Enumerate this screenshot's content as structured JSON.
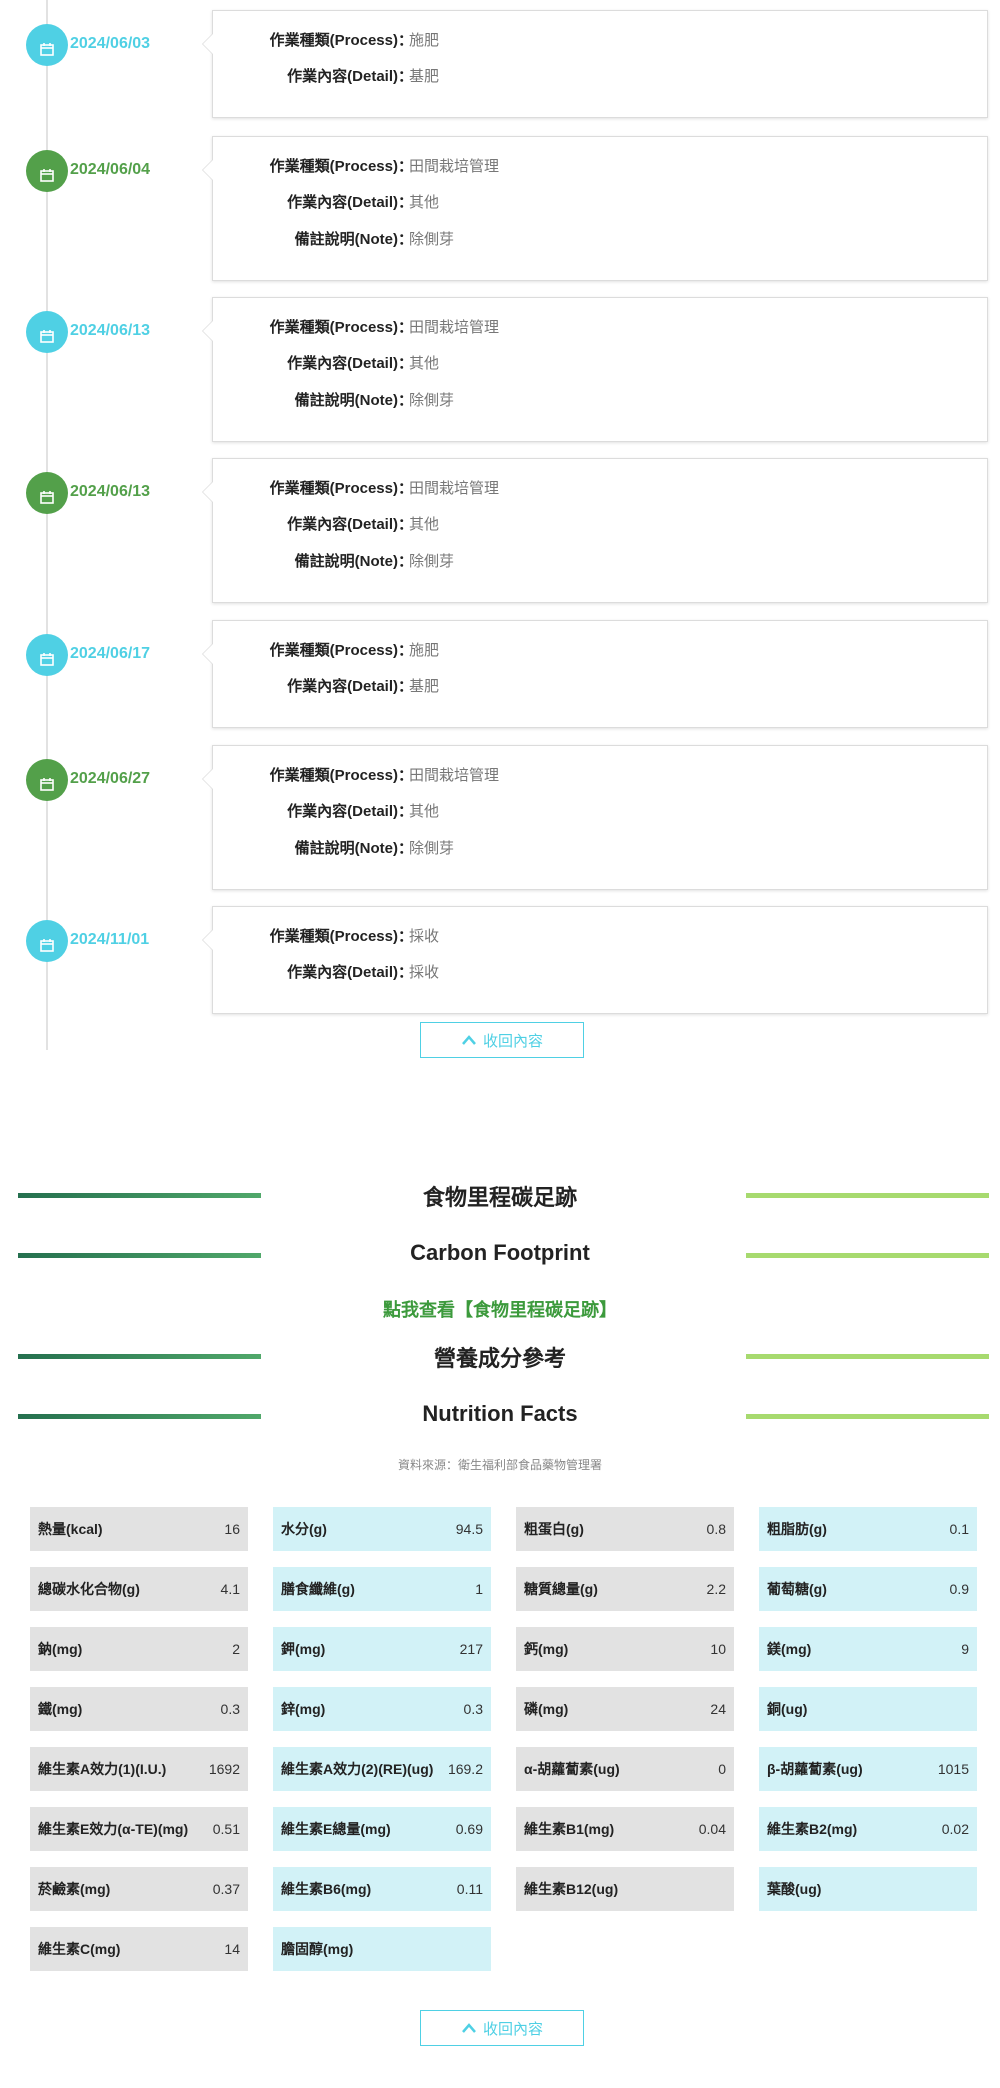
{
  "timeline": [
    {
      "date": "2024/06/03",
      "color": "cyan",
      "rows": [
        {
          "label": "作業種類(Process)：",
          "value": "施肥"
        },
        {
          "label": "作業內容(Detail)：",
          "value": "基肥"
        }
      ]
    },
    {
      "date": "2024/06/04",
      "color": "green",
      "rows": [
        {
          "label": "作業種類(Process)：",
          "value": "田間栽培管理"
        },
        {
          "label": "作業內容(Detail)：",
          "value": "其他"
        },
        {
          "label": "備註說明(Note)：",
          "value": "除側芽"
        }
      ]
    },
    {
      "date": "2024/06/13",
      "color": "cyan",
      "rows": [
        {
          "label": "作業種類(Process)：",
          "value": "田間栽培管理"
        },
        {
          "label": "作業內容(Detail)：",
          "value": "其他"
        },
        {
          "label": "備註說明(Note)：",
          "value": "除側芽"
        }
      ]
    },
    {
      "date": "2024/06/13",
      "color": "green",
      "rows": [
        {
          "label": "作業種類(Process)：",
          "value": "田間栽培管理"
        },
        {
          "label": "作業內容(Detail)：",
          "value": "其他"
        },
        {
          "label": "備註說明(Note)：",
          "value": "除側芽"
        }
      ]
    },
    {
      "date": "2024/06/17",
      "color": "cyan",
      "rows": [
        {
          "label": "作業種類(Process)：",
          "value": "施肥"
        },
        {
          "label": "作業內容(Detail)：",
          "value": "基肥"
        }
      ]
    },
    {
      "date": "2024/06/27",
      "color": "green",
      "rows": [
        {
          "label": "作業種類(Process)：",
          "value": "田間栽培管理"
        },
        {
          "label": "作業內容(Detail)：",
          "value": "其他"
        },
        {
          "label": "備註說明(Note)：",
          "value": "除側芽"
        }
      ]
    },
    {
      "date": "2024/11/01",
      "color": "cyan",
      "rows": [
        {
          "label": "作業種類(Process)：",
          "value": "採收"
        },
        {
          "label": "作業內容(Detail)：",
          "value": "採收"
        }
      ]
    }
  ],
  "collapse_label": "收回內容",
  "carbon": {
    "title_zh": "食物里程碳足跡",
    "title_en": "Carbon Footprint",
    "link": "點我查看【食物里程碳足跡】"
  },
  "nutrition": {
    "title_zh": "營養成分參考",
    "title_en": "Nutrition Facts",
    "source": "資料來源：衛生福利部食品藥物管理署",
    "items": [
      {
        "name": "熱量(kcal)",
        "value": "16"
      },
      {
        "name": "水分(g)",
        "value": "94.5"
      },
      {
        "name": "粗蛋白(g)",
        "value": "0.8"
      },
      {
        "name": "粗脂肪(g)",
        "value": "0.1"
      },
      {
        "name": "總碳水化合物(g)",
        "value": "4.1"
      },
      {
        "name": "膳食纖維(g)",
        "value": "1"
      },
      {
        "name": "糖質總量(g)",
        "value": "2.2"
      },
      {
        "name": "葡萄糖(g)",
        "value": "0.9"
      },
      {
        "name": "鈉(mg)",
        "value": "2"
      },
      {
        "name": "鉀(mg)",
        "value": "217"
      },
      {
        "name": "鈣(mg)",
        "value": "10"
      },
      {
        "name": "鎂(mg)",
        "value": "9"
      },
      {
        "name": "鐵(mg)",
        "value": "0.3"
      },
      {
        "name": "鋅(mg)",
        "value": "0.3"
      },
      {
        "name": "磷(mg)",
        "value": "24"
      },
      {
        "name": "銅(ug)",
        "value": ""
      },
      {
        "name": "維生素A效力(1)(I.U.)",
        "value": "1692"
      },
      {
        "name": "維生素A效力(2)(RE)(ug)",
        "value": "169.2"
      },
      {
        "name": "α-胡蘿蔔素(ug)",
        "value": "0"
      },
      {
        "name": "β-胡蘿蔔素(ug)",
        "value": "1015"
      },
      {
        "name": "維生素E效力(α-TE)(mg)",
        "value": "0.51"
      },
      {
        "name": "維生素E總量(mg)",
        "value": "0.69"
      },
      {
        "name": "維生素B1(mg)",
        "value": "0.04"
      },
      {
        "name": "維生素B2(mg)",
        "value": "0.02"
      },
      {
        "name": "菸鹼素(mg)",
        "value": "0.37"
      },
      {
        "name": "維生素B6(mg)",
        "value": "0.11"
      },
      {
        "name": "維生素B12(ug)",
        "value": ""
      },
      {
        "name": "葉酸(ug)",
        "value": ""
      },
      {
        "name": "維生素C(mg)",
        "value": "14"
      },
      {
        "name": "膽固醇(mg)",
        "value": ""
      }
    ]
  }
}
